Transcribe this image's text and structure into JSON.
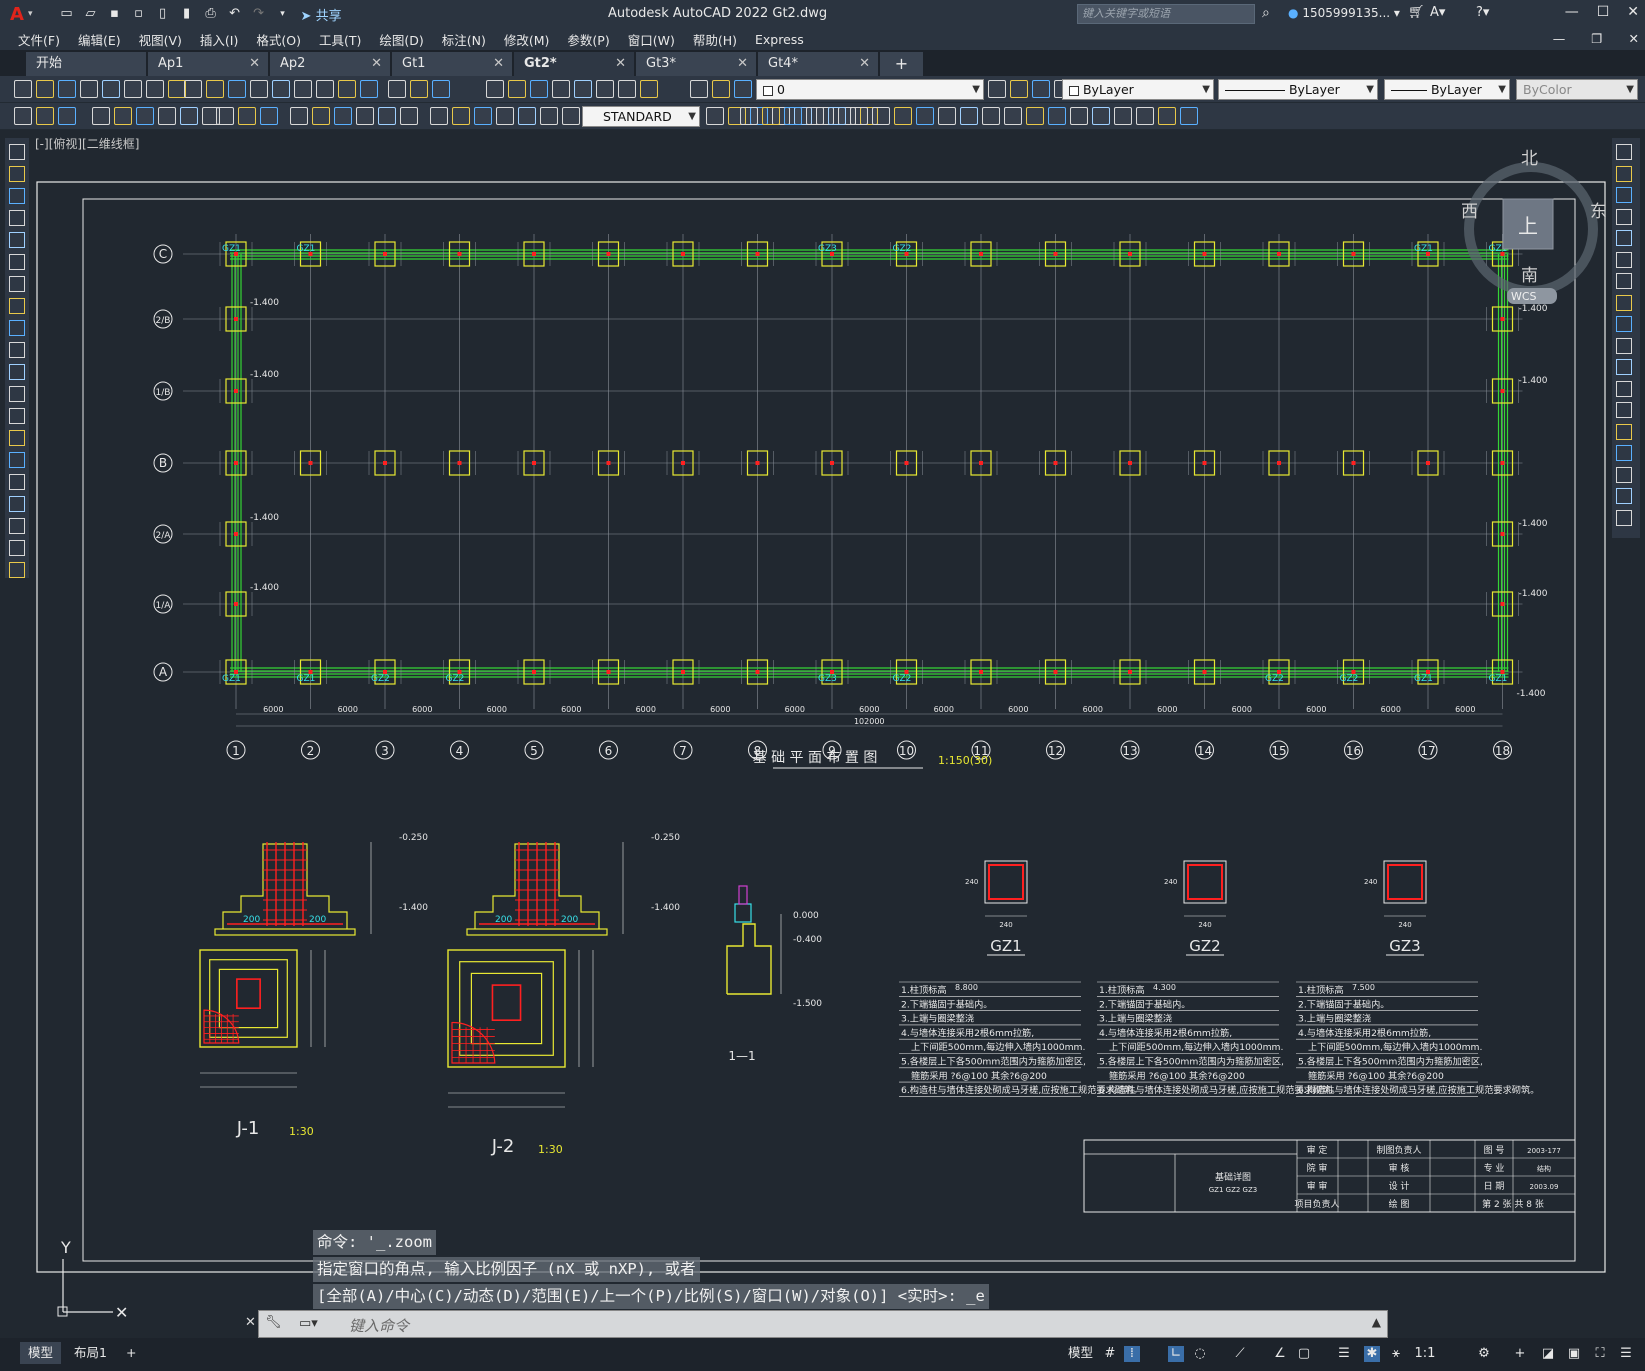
{
  "app": {
    "logo": "A",
    "title": "Autodesk AutoCAD 2022    Gt2.dwg",
    "share": "共享",
    "search_placeholder": "键入关键字或短语",
    "user": "1505999135...",
    "menu": [
      "文件(F)",
      "编辑(E)",
      "视图(V)",
      "插入(I)",
      "格式(O)",
      "工具(T)",
      "绘图(D)",
      "标注(N)",
      "修改(M)",
      "参数(P)",
      "窗口(W)",
      "帮助(H)",
      "Express"
    ]
  },
  "tabs": [
    {
      "label": "开始",
      "active": false
    },
    {
      "label": "Ap1",
      "active": false
    },
    {
      "label": "Ap2",
      "active": false
    },
    {
      "label": "Gt1",
      "active": false
    },
    {
      "label": "Gt2*",
      "active": true
    },
    {
      "label": "Gt3*",
      "active": false
    },
    {
      "label": "Gt4*",
      "active": false
    }
  ],
  "toolbar": {
    "layer_value": "0",
    "color_value": "ByLayer",
    "linetype_value": "ByLayer",
    "lineweight_value": "ByLayer",
    "plotstyle_value": "ByColor",
    "textstyle_value": "STANDARD"
  },
  "viewport": {
    "label": "[-][俯视][二维线框]",
    "viewcube": {
      "north": "北",
      "south": "南",
      "east": "东",
      "west": "西",
      "face": "上",
      "wcs": "WCS"
    }
  },
  "drawing": {
    "plan_title": "基 础 平 面 布 置 图",
    "plan_scale": "1:150(30)",
    "column_labels": [
      "1",
      "2",
      "3",
      "4",
      "5",
      "6",
      "7",
      "8",
      "9",
      "10",
      "11",
      "12",
      "13",
      "14",
      "15",
      "16",
      "17",
      "18"
    ],
    "row_labels": [
      "C",
      "2/B",
      "1/B",
      "B",
      "2/A",
      "1/A",
      "A"
    ],
    "span_dim": "6000",
    "total_dim": "102000",
    "elev": "-1.400",
    "details": {
      "j1_label": "J-1",
      "j1_scale": "1:30",
      "j2_label": "J-2",
      "j2_scale": "1:30",
      "sec_label": "1—1",
      "elev_top": "-0.250",
      "elev_bot": "-1.400",
      "elev_000": "0.000",
      "elev_040": "-0.400",
      "elev_150": "-1.500",
      "gz_labels": [
        "GZ1",
        "GZ2",
        "GZ3"
      ],
      "gz_dim": "240"
    },
    "gz_notes": [
      {
        "height": "8.800",
        "lines": [
          "1.柱顶标高",
          "2.下端锚固于基础内。",
          "3.上端与圈梁整浇",
          "4.与墙体连接采用2根6mm拉筋,",
          "上下间距500mm,每边伸入墙内1000mm.",
          "5.各楼层上下各500mm范围内为箍筋加密区,",
          "箍筋采用 ?6@100 其余?6@200",
          "6.构造柱与墙体连接处砌成马牙槎,应按施工规范要求砌筑。"
        ]
      },
      {
        "height": "4.300",
        "lines": [
          "1.柱顶标高",
          "2.下端锚固于基础内。",
          "3.上端与圈梁整浇",
          "4.与墙体连接采用2根6mm拉筋,",
          "上下间距500mm,每边伸入墙内1000mm.",
          "5.各楼层上下各500mm范围内为箍筋加密区,",
          "箍筋采用 ?6@100 其余?6@200",
          "6.构造柱与墙体连接处砌成马牙槎,应按施工规范要求砌筑。"
        ]
      },
      {
        "height": "7.500",
        "lines": [
          "1.柱顶标高",
          "2.下端锚固于基础内。",
          "3.上端与圈梁整浇",
          "4.与墙体连接采用2根6mm拉筋,",
          "上下间距500mm,每边伸入墙内1000mm.",
          "5.各楼层上下各500mm范围内为箍筋加密区,",
          "箍筋采用 ?6@100 其余?6@200",
          "6.构造柱与墙体连接处砌成马牙槎,应按施工规范要求砌筑。"
        ]
      }
    ],
    "titleblock": {
      "proj": "基础详图",
      "sub": "GZ1 GZ2 GZ3",
      "labels": [
        "审 定",
        "院 审",
        "审 审",
        "项目负责人",
        "制图负责人",
        "审 核",
        "设 计",
        "绘 图"
      ],
      "right_labels": [
        "图 号",
        "专 业",
        "日 期"
      ],
      "right_values": [
        "2003-177",
        "结构",
        "2003.09",
        "第 2 张 共 8 张"
      ]
    }
  },
  "cmd": {
    "lines": [
      "命令: '_.zoom",
      "指定窗口的角点, 输入比例因子 (nX 或 nXP), 或者",
      "[全部(A)/中心(C)/动态(D)/范围(E)/上一个(P)/比例(S)/窗口(W)/对象(O)] <实时>: _e"
    ],
    "input_placeholder": "键入命令"
  },
  "status": {
    "tab_model": "模型",
    "tab_layout1": "布局1",
    "add": "+",
    "model_btn": "模型",
    "scale": "1:1"
  },
  "colors": {
    "bg": "#212830",
    "grid": "#8a9099",
    "green": "#35d435",
    "yellow": "#e8e832",
    "red": "#ff2020",
    "cyan": "#38e0e8",
    "white": "#e8e8e8"
  }
}
